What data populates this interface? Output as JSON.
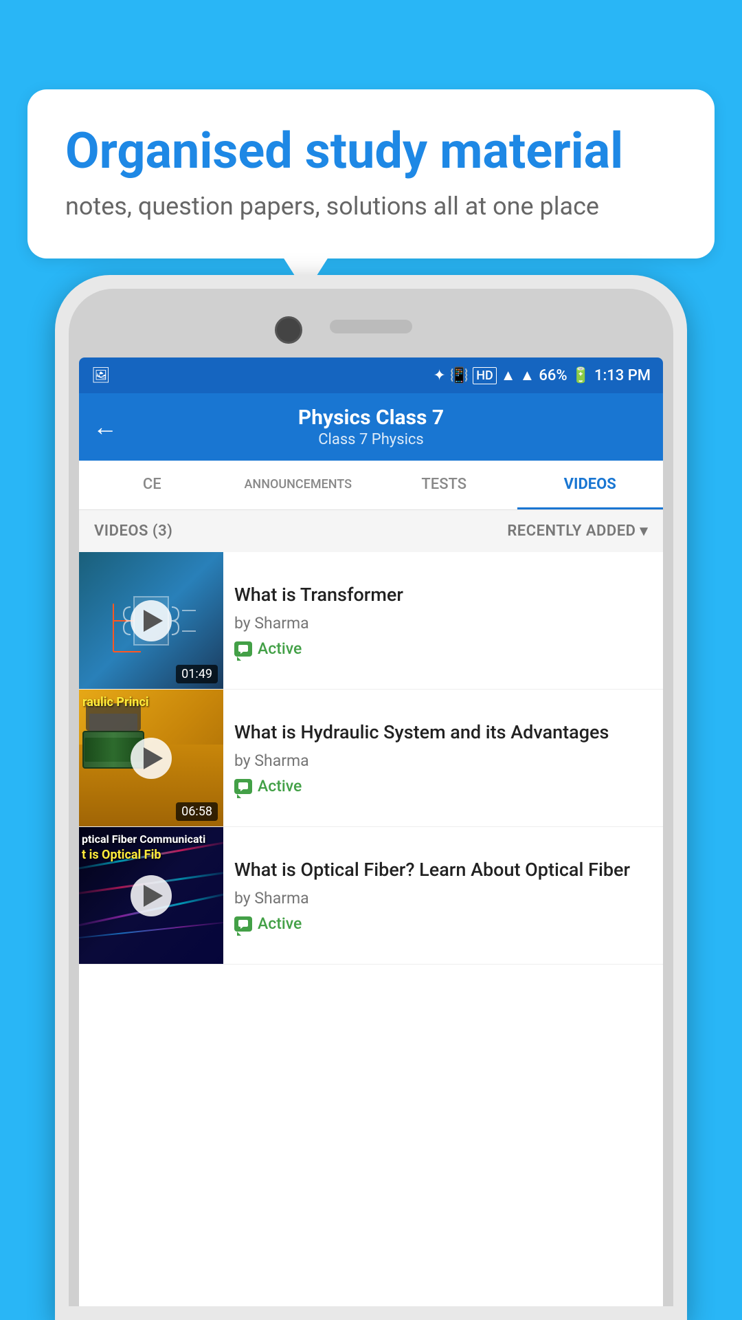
{
  "background_color": "#29b6f6",
  "hero": {
    "title": "Organised study material",
    "subtitle": "notes, question papers, solutions all at one place"
  },
  "status_bar": {
    "time": "1:13 PM",
    "battery": "66%",
    "signal_icons": "📶"
  },
  "top_bar": {
    "title": "Physics Class 7",
    "breadcrumb": "Class 7   Physics",
    "back_label": "←"
  },
  "tabs": [
    {
      "id": "ce",
      "label": "CE",
      "active": false
    },
    {
      "id": "announcements",
      "label": "ANNOUNCEMENTS",
      "active": false
    },
    {
      "id": "tests",
      "label": "TESTS",
      "active": false
    },
    {
      "id": "videos",
      "label": "VIDEOS",
      "active": true
    }
  ],
  "videos_section": {
    "count_label": "VIDEOS (3)",
    "sort_label": "RECENTLY ADDED",
    "chevron": "▾"
  },
  "videos": [
    {
      "title": "What is  Transformer",
      "author": "by Sharma",
      "status": "Active",
      "duration": "01:49",
      "thumb_type": "transformer",
      "thumb_label": ""
    },
    {
      "title": "What is Hydraulic System and its Advantages",
      "author": "by Sharma",
      "status": "Active",
      "duration": "06:58",
      "thumb_type": "hydraulic",
      "thumb_label": "raulic Princi"
    },
    {
      "title": "What is Optical Fiber? Learn About Optical Fiber",
      "author": "by Sharma",
      "status": "Active",
      "duration": "",
      "thumb_type": "optical",
      "thumb_label": "ptical Fiber Communicati\nt is Optical Fib"
    }
  ]
}
